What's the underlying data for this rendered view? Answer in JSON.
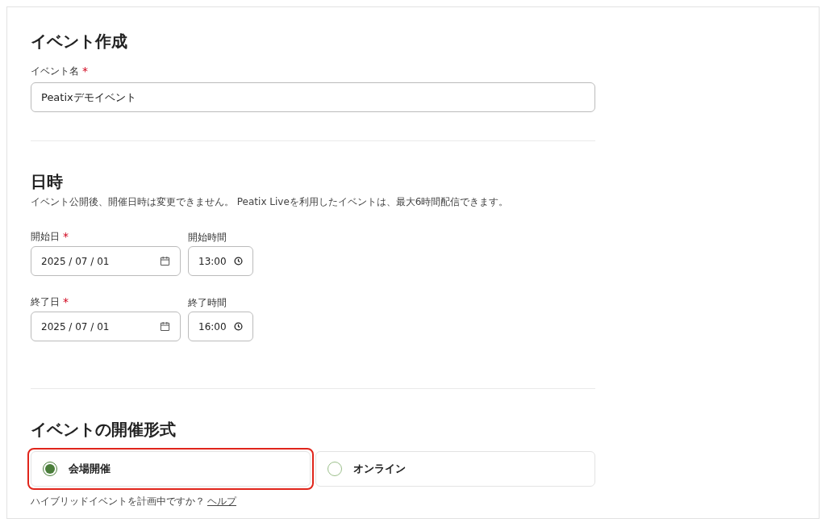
{
  "sections": [
    {
      "kind": "name",
      "title": "イベント作成",
      "field": {
        "label": "イベント名",
        "required_mark": "*",
        "value": "Peatixデモイベント"
      }
    },
    {
      "kind": "datetime",
      "title": "日時",
      "note": "イベント公開後、開催日時は変更できません。 Peatix Liveを利用したイベントは、最大6時間配信できます。",
      "rows": [
        {
          "date_label": "開始日",
          "date_required_mark": "*",
          "date": "2025 / 07 / 01",
          "time_label": "開始時間",
          "time": "13:00"
        },
        {
          "date_label": "終了日",
          "date_required_mark": "*",
          "date": "2025 / 07 / 01",
          "time_label": "終了時間",
          "time": "16:00"
        }
      ]
    },
    {
      "kind": "format",
      "title": "イベントの開催形式",
      "options": [
        {
          "label": "会場開催",
          "selected": true,
          "highlighted": true
        },
        {
          "label": "オンライン",
          "selected": false,
          "highlighted": false
        }
      ],
      "hint": "ハイブリッドイベントを計画中ですか？",
      "help_link": "ヘルプ"
    }
  ]
}
